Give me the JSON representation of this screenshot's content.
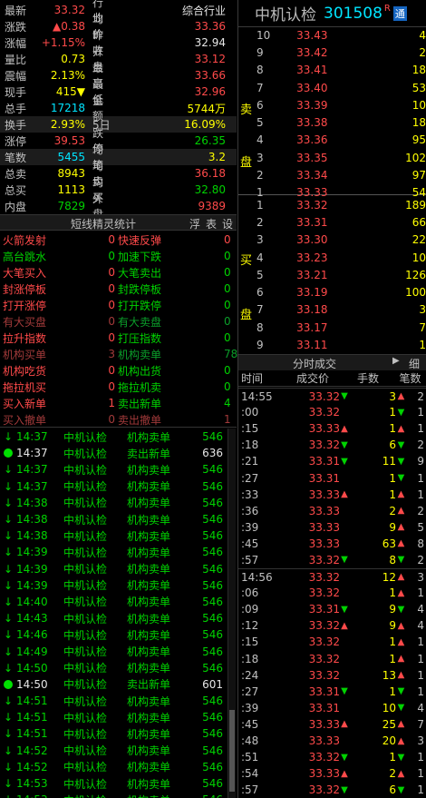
{
  "quote": {
    "rows": [
      {
        "k": "最新",
        "v": "33.32",
        "c1": "red",
        "k2": "行业",
        "v2": "综合行业",
        "c2": "wht"
      },
      {
        "k": "涨跌",
        "v": "▲0.38",
        "c1": "red",
        "k2": "均价",
        "v2": "33.36",
        "c2": "red"
      },
      {
        "k": "涨幅",
        "v": "+1.15%",
        "c1": "red",
        "k2": "昨收",
        "v2": "32.94",
        "c2": "wht"
      },
      {
        "k": "量比",
        "v": "0.73",
        "c1": "yel",
        "k2": "开盘",
        "v2": "33.12",
        "c2": "red"
      },
      {
        "k": "震幅",
        "v": "2.13%",
        "c1": "yel",
        "k2": "最高",
        "v2": "33.66",
        "c2": "red"
      },
      {
        "k": "现手",
        "v": "415▼",
        "c1": "yel",
        "k2": "最低",
        "v2": "32.96",
        "c2": "red"
      },
      {
        "k": "总手",
        "v": "17218",
        "c1": "cyn",
        "k2": "金额",
        "v2": "5744万",
        "c2": "yel"
      },
      {
        "k": "换手",
        "v": "2.93%",
        "c1": "yel",
        "k2": "5日",
        "v2": "16.09%",
        "c2": "yel"
      },
      {
        "k": "涨停",
        "v": "39.53",
        "c1": "red",
        "k2": "跌停",
        "v2": "26.35",
        "c2": "grn"
      },
      {
        "k": "笔数",
        "v": "5455",
        "c1": "cyn",
        "k2": "均笔",
        "v2": "3.2",
        "c2": "yel"
      },
      {
        "k": "总卖",
        "v": "8943",
        "c1": "yel",
        "k2": "均卖",
        "v2": "36.18",
        "c2": "red"
      },
      {
        "k": "总买",
        "v": "1113",
        "c1": "yel",
        "k2": "均买",
        "v2": "32.80",
        "c2": "grn"
      },
      {
        "k": "内盘",
        "v": "7829",
        "c1": "grn",
        "k2": "外盘",
        "v2": "9389",
        "c2": "red"
      }
    ]
  },
  "sprite": {
    "title": "短线精灵统计",
    "tabs": [
      "浮",
      "表",
      "设"
    ],
    "rows": [
      {
        "a": "火箭发射",
        "an": "0",
        "ac": "red",
        "b": "快速反弹",
        "bn": "0",
        "bc": "red"
      },
      {
        "a": "高台跳水",
        "an": "0",
        "ac": "grn",
        "b": "加速下跌",
        "bn": "0",
        "bc": "grn"
      },
      {
        "a": "大笔买入",
        "an": "0",
        "ac": "red",
        "b": "大笔卖出",
        "bn": "0",
        "bc": "grn"
      },
      {
        "a": "封涨停板",
        "an": "0",
        "ac": "red",
        "b": "封跌停板",
        "bn": "0",
        "bc": "grn"
      },
      {
        "a": "打开涨停",
        "an": "0",
        "ac": "red",
        "b": "打开跌停",
        "bn": "0",
        "bc": "grn"
      },
      {
        "a": "有大买盘",
        "an": "0",
        "ac": "dred",
        "b": "有大卖盘",
        "bn": "0",
        "bc": "dgrn"
      },
      {
        "a": "拉升指数",
        "an": "0",
        "ac": "red",
        "b": "打压指数",
        "bn": "0",
        "bc": "grn"
      },
      {
        "a": "机构买单",
        "an": "3",
        "ac": "dred",
        "b": "机构卖单",
        "bn": "78",
        "bc": "dgrn"
      },
      {
        "a": "机构吃货",
        "an": "0",
        "ac": "red",
        "b": "机构出货",
        "bn": "0",
        "bc": "grn"
      },
      {
        "a": "拖拉机买",
        "an": "0",
        "ac": "red",
        "b": "拖拉机卖",
        "bn": "0",
        "bc": "grn"
      },
      {
        "a": "买入新单",
        "an": "1",
        "ac": "red",
        "b": "卖出新单",
        "bn": "4",
        "bc": "grn"
      },
      {
        "a": "买入撤单",
        "an": "0",
        "ac": "dred",
        "b": "卖出撤单",
        "bn": "1",
        "bc": "dred"
      }
    ]
  },
  "monitor": [
    {
      "t": "14:37",
      "n": "中机认检",
      "e": "机构卖单",
      "v": "546",
      "dot": false
    },
    {
      "t": "14:37",
      "n": "中机认检",
      "e": "卖出新单",
      "v": "636",
      "dot": true
    },
    {
      "t": "14:37",
      "n": "中机认检",
      "e": "机构卖单",
      "v": "546",
      "dot": false
    },
    {
      "t": "14:37",
      "n": "中机认检",
      "e": "机构卖单",
      "v": "546",
      "dot": false
    },
    {
      "t": "14:38",
      "n": "中机认检",
      "e": "机构卖单",
      "v": "546",
      "dot": false
    },
    {
      "t": "14:38",
      "n": "中机认检",
      "e": "机构卖单",
      "v": "546",
      "dot": false
    },
    {
      "t": "14:38",
      "n": "中机认检",
      "e": "机构卖单",
      "v": "546",
      "dot": false
    },
    {
      "t": "14:39",
      "n": "中机认检",
      "e": "机构卖单",
      "v": "546",
      "dot": false
    },
    {
      "t": "14:39",
      "n": "中机认检",
      "e": "机构卖单",
      "v": "546",
      "dot": false
    },
    {
      "t": "14:39",
      "n": "中机认检",
      "e": "机构卖单",
      "v": "546",
      "dot": false
    },
    {
      "t": "14:40",
      "n": "中机认检",
      "e": "机构卖单",
      "v": "546",
      "dot": false
    },
    {
      "t": "14:43",
      "n": "中机认检",
      "e": "机构卖单",
      "v": "546",
      "dot": false
    },
    {
      "t": "14:46",
      "n": "中机认检",
      "e": "机构卖单",
      "v": "546",
      "dot": false
    },
    {
      "t": "14:49",
      "n": "中机认检",
      "e": "机构卖单",
      "v": "546",
      "dot": false
    },
    {
      "t": "14:50",
      "n": "中机认检",
      "e": "机构卖单",
      "v": "546",
      "dot": false
    },
    {
      "t": "14:50",
      "n": "中机认检",
      "e": "卖出新单",
      "v": "601",
      "dot": true
    },
    {
      "t": "14:51",
      "n": "中机认检",
      "e": "机构卖单",
      "v": "546",
      "dot": false
    },
    {
      "t": "14:51",
      "n": "中机认检",
      "e": "机构卖单",
      "v": "546",
      "dot": false
    },
    {
      "t": "14:51",
      "n": "中机认检",
      "e": "机构卖单",
      "v": "546",
      "dot": false
    },
    {
      "t": "14:52",
      "n": "中机认检",
      "e": "机构卖单",
      "v": "546",
      "dot": false
    },
    {
      "t": "14:52",
      "n": "中机认检",
      "e": "机构卖单",
      "v": "546",
      "dot": false
    },
    {
      "t": "14:53",
      "n": "中机认检",
      "e": "机构卖单",
      "v": "546",
      "dot": false
    },
    {
      "t": "14:53",
      "n": "中机认检",
      "e": "机构卖单",
      "v": "546",
      "dot": false
    }
  ],
  "header": {
    "name": "中机认检",
    "code": "301508",
    "badge_r": "R",
    "badge_t": "通"
  },
  "book": {
    "sell_label": [
      "卖",
      "盘"
    ],
    "buy_label": [
      "买",
      "盘"
    ],
    "sell": [
      {
        "l": "10",
        "p": "33.43",
        "v": "4"
      },
      {
        "l": "9",
        "p": "33.42",
        "v": "2"
      },
      {
        "l": "8",
        "p": "33.41",
        "v": "18"
      },
      {
        "l": "7",
        "p": "33.40",
        "v": "53"
      },
      {
        "l": "6",
        "p": "33.39",
        "v": "10"
      },
      {
        "l": "5",
        "p": "33.38",
        "v": "18"
      },
      {
        "l": "4",
        "p": "33.36",
        "v": "95"
      },
      {
        "l": "3",
        "p": "33.35",
        "v": "102"
      },
      {
        "l": "2",
        "p": "33.34",
        "v": "97"
      },
      {
        "l": "1",
        "p": "33.33",
        "v": "54"
      }
    ],
    "buy": [
      {
        "l": "1",
        "p": "33.32",
        "v": "189"
      },
      {
        "l": "2",
        "p": "33.31",
        "v": "66"
      },
      {
        "l": "3",
        "p": "33.30",
        "v": "22"
      },
      {
        "l": "4",
        "p": "33.23",
        "v": "10"
      },
      {
        "l": "5",
        "p": "33.21",
        "v": "126"
      },
      {
        "l": "6",
        "p": "33.19",
        "v": "100"
      },
      {
        "l": "7",
        "p": "33.18",
        "v": "3"
      },
      {
        "l": "8",
        "p": "33.17",
        "v": "7"
      },
      {
        "l": "9",
        "p": "33.11",
        "v": "1"
      },
      {
        "l": "10",
        "p": "33.08",
        "v": "8"
      }
    ]
  },
  "ticks_header": {
    "title": "分时成交",
    "detail": "细",
    "cols": [
      "时间",
      "成交价",
      "手数",
      "笔数"
    ]
  },
  "ticks": [
    {
      "t": "14:55",
      "p": "33.32",
      "s": "dn",
      "v": "3",
      "d": "up",
      "n": "2"
    },
    {
      "t": ":00",
      "p": "33.32",
      "s": "",
      "v": "1",
      "d": "dn",
      "n": "1"
    },
    {
      "t": ":15",
      "p": "33.33",
      "s": "up",
      "v": "1",
      "d": "up",
      "n": "1"
    },
    {
      "t": ":18",
      "p": "33.32",
      "s": "dn",
      "v": "6",
      "d": "dn",
      "n": "2"
    },
    {
      "t": ":21",
      "p": "33.31",
      "s": "dn",
      "v": "11",
      "d": "dn",
      "n": "9"
    },
    {
      "t": ":27",
      "p": "33.31",
      "s": "",
      "v": "1",
      "d": "dn",
      "n": "1"
    },
    {
      "t": ":33",
      "p": "33.33",
      "s": "up",
      "v": "1",
      "d": "up",
      "n": "1"
    },
    {
      "t": ":36",
      "p": "33.33",
      "s": "",
      "v": "2",
      "d": "up",
      "n": "2"
    },
    {
      "t": ":39",
      "p": "33.33",
      "s": "",
      "v": "9",
      "d": "up",
      "n": "5"
    },
    {
      "t": ":45",
      "p": "33.33",
      "s": "",
      "v": "63",
      "d": "up",
      "n": "8"
    },
    {
      "t": ":57",
      "p": "33.32",
      "s": "dn",
      "v": "8",
      "d": "dn",
      "n": "2"
    },
    {
      "t": "14:56",
      "p": "33.32",
      "s": "",
      "v": "12",
      "d": "up",
      "n": "3"
    },
    {
      "t": ":06",
      "p": "33.32",
      "s": "",
      "v": "1",
      "d": "up",
      "n": "1"
    },
    {
      "t": ":09",
      "p": "33.31",
      "s": "dn",
      "v": "9",
      "d": "dn",
      "n": "4"
    },
    {
      "t": ":12",
      "p": "33.32",
      "s": "up",
      "v": "9",
      "d": "up",
      "n": "4"
    },
    {
      "t": ":15",
      "p": "33.32",
      "s": "",
      "v": "1",
      "d": "up",
      "n": "1"
    },
    {
      "t": ":18",
      "p": "33.32",
      "s": "",
      "v": "1",
      "d": "up",
      "n": "1"
    },
    {
      "t": ":24",
      "p": "33.32",
      "s": "",
      "v": "13",
      "d": "up",
      "n": "1"
    },
    {
      "t": ":27",
      "p": "33.31",
      "s": "dn",
      "v": "1",
      "d": "dn",
      "n": "1"
    },
    {
      "t": ":39",
      "p": "33.31",
      "s": "",
      "v": "10",
      "d": "dn",
      "n": "4"
    },
    {
      "t": ":45",
      "p": "33.33",
      "s": "up",
      "v": "25",
      "d": "up",
      "n": "7"
    },
    {
      "t": ":48",
      "p": "33.33",
      "s": "",
      "v": "20",
      "d": "up",
      "n": "3"
    },
    {
      "t": ":51",
      "p": "33.32",
      "s": "dn",
      "v": "1",
      "d": "dn",
      "n": "1"
    },
    {
      "t": ":54",
      "p": "33.33",
      "s": "up",
      "v": "2",
      "d": "up",
      "n": "1"
    },
    {
      "t": ":57",
      "p": "33.32",
      "s": "dn",
      "v": "6",
      "d": "dn",
      "n": "1"
    }
  ]
}
